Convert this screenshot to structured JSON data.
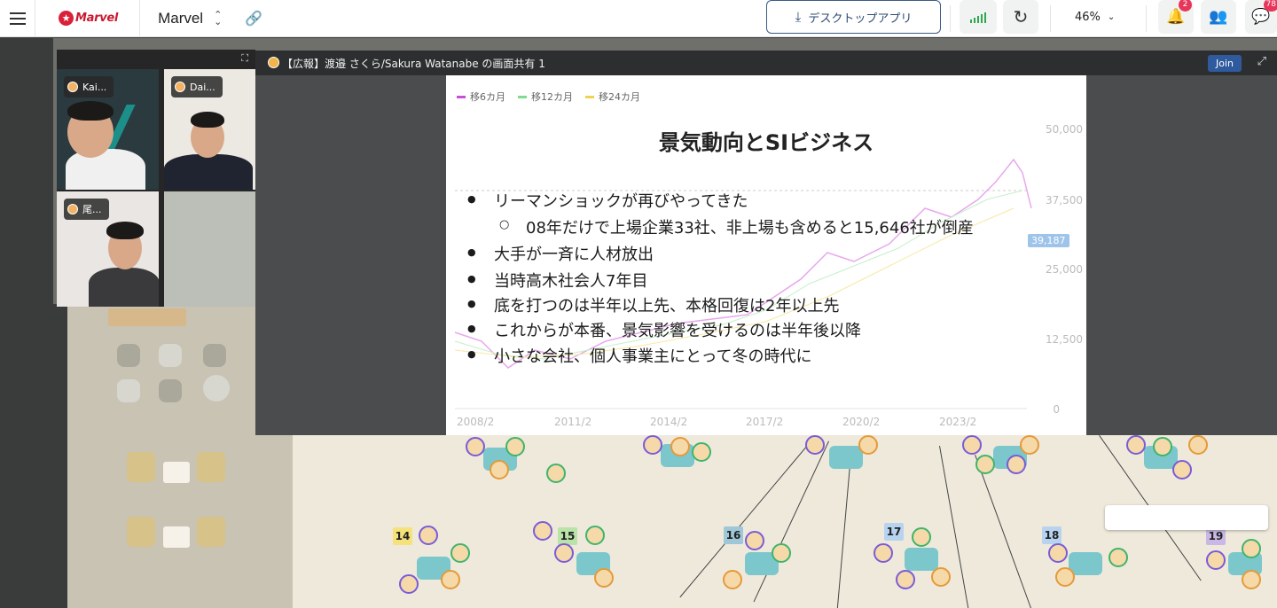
{
  "topbar": {
    "logo_text": "Marvel",
    "space_name": "Marvel",
    "desktop_app_label": "デスクトップアプリ",
    "zoom": "46%",
    "notification_count": "2",
    "chat_count": "78"
  },
  "videos": [
    {
      "name": "Kai..."
    },
    {
      "name": "Dai..."
    },
    {
      "name": "尾..."
    }
  ],
  "share": {
    "title": "【広報】渡邉 さくら/Sakura Watanabe の画面共有 1",
    "join_label": "Join"
  },
  "slide": {
    "title": "景気動向とSIビジネス",
    "legend": [
      "移6カ月",
      "移12カ月",
      "移24カ月"
    ],
    "bullets": [
      "リーマンショックが再びやってきた",
      "08年だけで上場企業33社、非上場も含めると15,646社が倒産",
      "大手が一斉に人材放出",
      "当時高木社会人7年目",
      "底を打つのは半年以上先、本格回復は2年以上先",
      "これからが本番、景気影響を受けるのは半年後以降",
      "小さな会社、個人事業主にとって冬の時代に"
    ],
    "yticks": [
      "50,000",
      "37,500",
      "25,000",
      "12,500",
      "0"
    ],
    "xticks": [
      "2008/2",
      "2011/2",
      "2014/2",
      "2017/2",
      "2020/2",
      "2023/2"
    ],
    "price": "39,187"
  },
  "world": {
    "table_numbers": [
      "14",
      "15",
      "16",
      "17",
      "18",
      "19"
    ]
  },
  "colors": {
    "legend": [
      "#c64fd6",
      "#7fdc8c",
      "#f1d34a"
    ],
    "accent": "#2f5b9e"
  }
}
